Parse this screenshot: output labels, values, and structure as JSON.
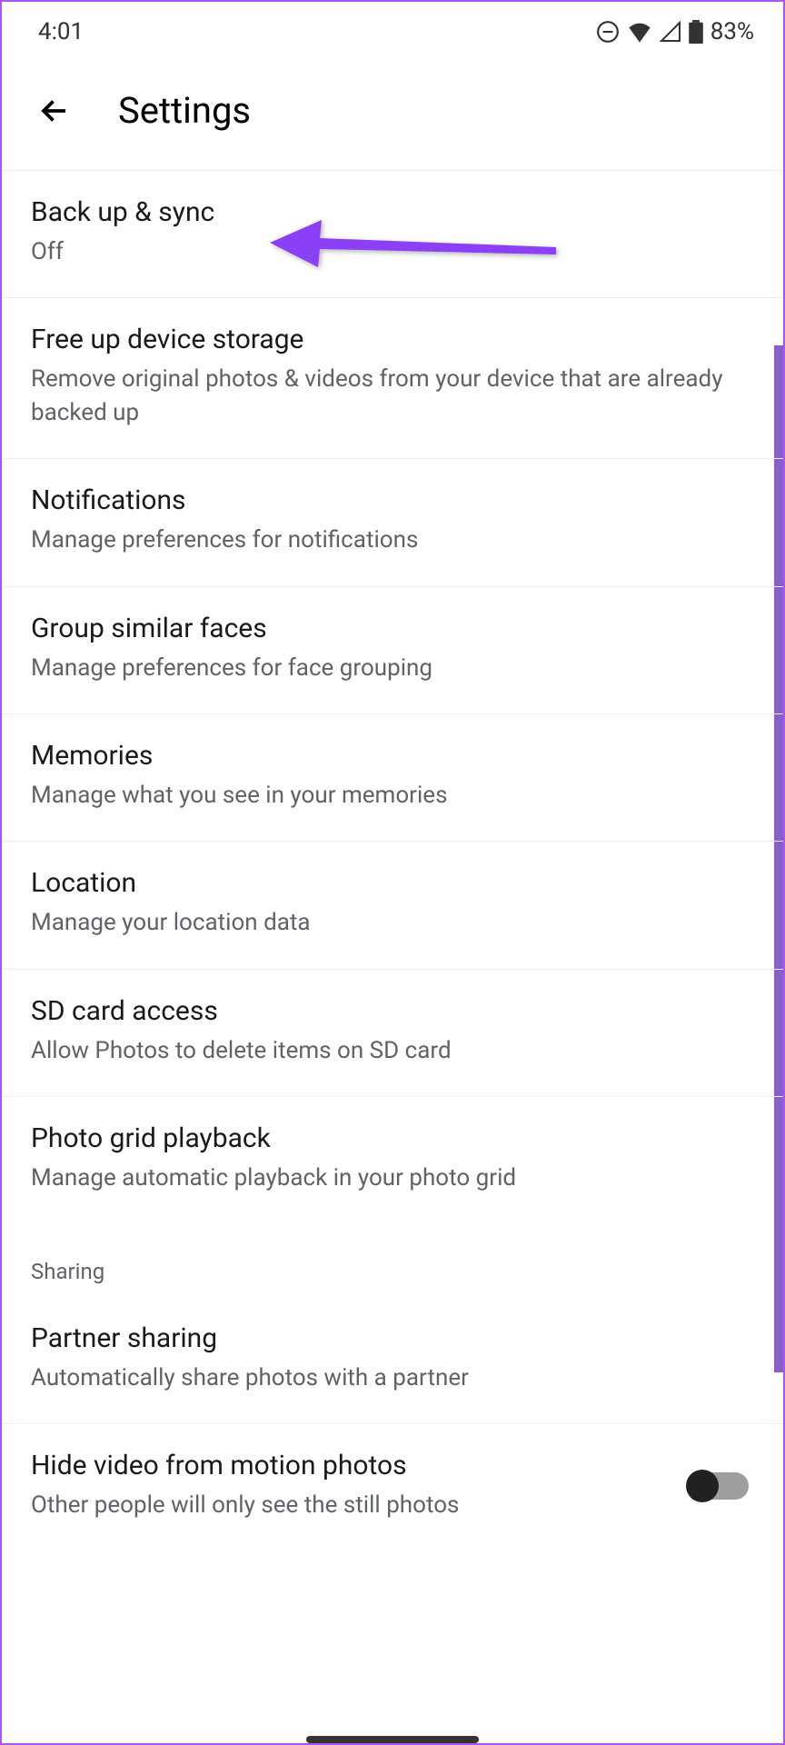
{
  "statusBar": {
    "time": "4:01",
    "battery": "83%"
  },
  "header": {
    "title": "Settings"
  },
  "settings": [
    {
      "title": "Back up & sync",
      "subtitle": "Off"
    },
    {
      "title": "Free up device storage",
      "subtitle": "Remove original photos & videos from your device that are already backed up"
    },
    {
      "title": "Notifications",
      "subtitle": "Manage preferences for notifications"
    },
    {
      "title": "Group similar faces",
      "subtitle": "Manage preferences for face grouping"
    },
    {
      "title": "Memories",
      "subtitle": "Manage what you see in your memories"
    },
    {
      "title": "Location",
      "subtitle": "Manage your location data"
    },
    {
      "title": "SD card access",
      "subtitle": "Allow Photos to delete items on SD card"
    },
    {
      "title": "Photo grid playback",
      "subtitle": "Manage automatic playback in your photo grid"
    }
  ],
  "sectionHeaders": {
    "sharing": "Sharing"
  },
  "sharingSettings": [
    {
      "title": "Partner sharing",
      "subtitle": "Automatically share photos with a partner"
    },
    {
      "title": "Hide video from motion photos",
      "subtitle": "Other people will only see the still photos"
    }
  ]
}
